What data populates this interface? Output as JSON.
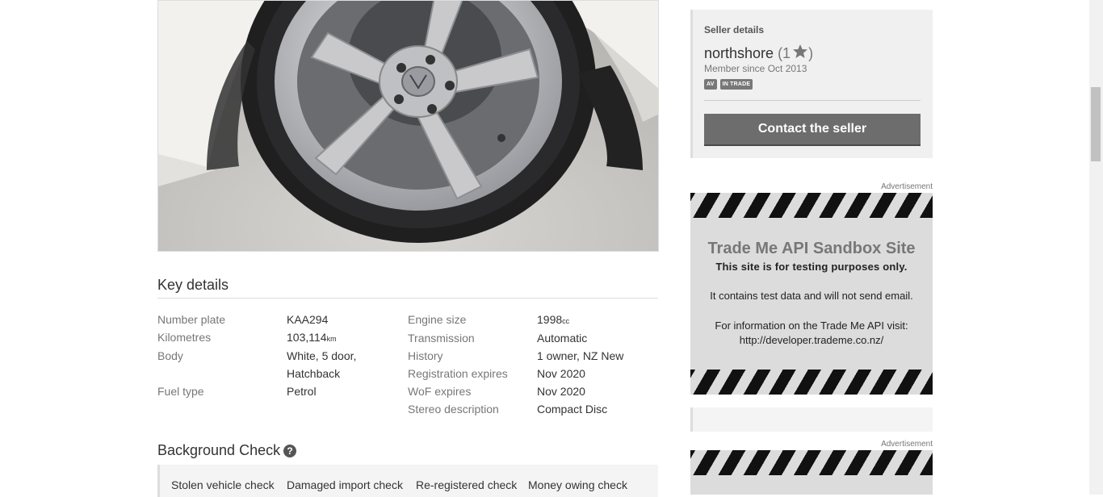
{
  "key_details": {
    "title": "Key details",
    "left": [
      {
        "label": "Number plate",
        "value": "KAA294",
        "unit": ""
      },
      {
        "label": "Kilometres",
        "value": "103,114",
        "unit": "km"
      },
      {
        "label": "Body",
        "value": "White, 5 door,",
        "value2": "Hatchback",
        "unit": ""
      },
      {
        "label": "Fuel type",
        "value": "Petrol",
        "unit": ""
      }
    ],
    "right": [
      {
        "label": "Engine size",
        "value": "1998",
        "unit": "cc"
      },
      {
        "label": "Transmission",
        "value": "Automatic",
        "unit": ""
      },
      {
        "label": "History",
        "value": "1 owner, NZ New",
        "unit": ""
      },
      {
        "label": "Registration expires",
        "value": "Nov 2020",
        "unit": ""
      },
      {
        "label": "WoF expires",
        "value": "Nov 2020",
        "unit": ""
      },
      {
        "label": "Stereo description",
        "value": "Compact Disc",
        "unit": ""
      }
    ]
  },
  "background_check": {
    "title": "Background Check",
    "help_glyph": "?",
    "items": [
      "Stolen vehicle check",
      "Damaged import check",
      "Re-registered check",
      "Money owing check"
    ]
  },
  "seller": {
    "heading": "Seller details",
    "name": "northshore",
    "open_paren": "(1",
    "close_paren": ")",
    "member_since": "Member since Oct 2013",
    "badges": [
      "AV",
      "IN TRADE"
    ],
    "contact_label": "Contact the seller"
  },
  "ads": [
    {
      "label": "Advertisement",
      "title": "Trade Me API Sandbox Site",
      "subtitle": "This site is for testing purposes only.",
      "line1": "It contains test data and will not send email.",
      "line2": "For information on the Trade Me API visit:",
      "line3": "http://developer.trademe.co.nz/"
    },
    {
      "label": "Advertisement"
    }
  ],
  "colors": {
    "accent_button": "#6d6d6d",
    "stripe": "#111111",
    "ad_background": "#dcdcdc"
  }
}
